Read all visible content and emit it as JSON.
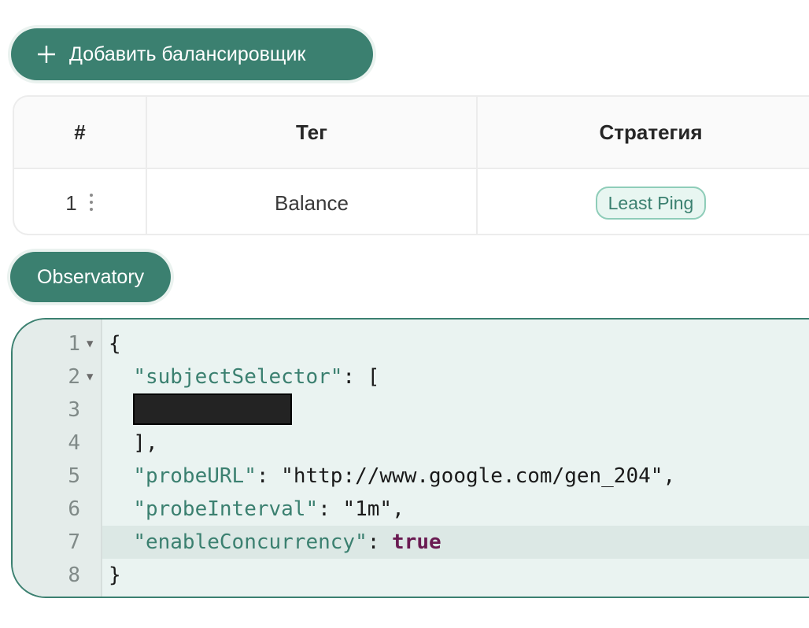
{
  "toolbar": {
    "add_balancer_label": "Добавить балансировщик"
  },
  "table": {
    "headers": {
      "num": "#",
      "tag": "Тег",
      "strategy": "Стратегия"
    },
    "rows": [
      {
        "num": "1",
        "tag": "Balance",
        "strategy": "Least Ping"
      }
    ]
  },
  "observatory": {
    "toggle_label": "Observatory"
  },
  "editor": {
    "lines": [
      {
        "n": "1",
        "text": "{"
      },
      {
        "n": "2",
        "key": "\"subjectSelector\"",
        "after": ": ["
      },
      {
        "n": "3"
      },
      {
        "n": "4",
        "text": "  ],"
      },
      {
        "n": "5",
        "key": "\"probeURL\"",
        "sep": ": ",
        "val": "\"http://www.google.com/gen_204\"",
        "tail": ","
      },
      {
        "n": "6",
        "key": "\"probeInterval\"",
        "sep": ": ",
        "val": "\"1m\"",
        "tail": ","
      },
      {
        "n": "7",
        "key": "\"enableConcurrency\"",
        "sep": ": ",
        "bool": "true"
      },
      {
        "n": "8",
        "text": "}"
      }
    ]
  },
  "colors": {
    "accent": "#3b8070",
    "tag_border": "#8fcdb9",
    "tag_bg": "#e8f6f1",
    "editor_bg": "#eaf3f1",
    "bool": "#6a1b52"
  }
}
